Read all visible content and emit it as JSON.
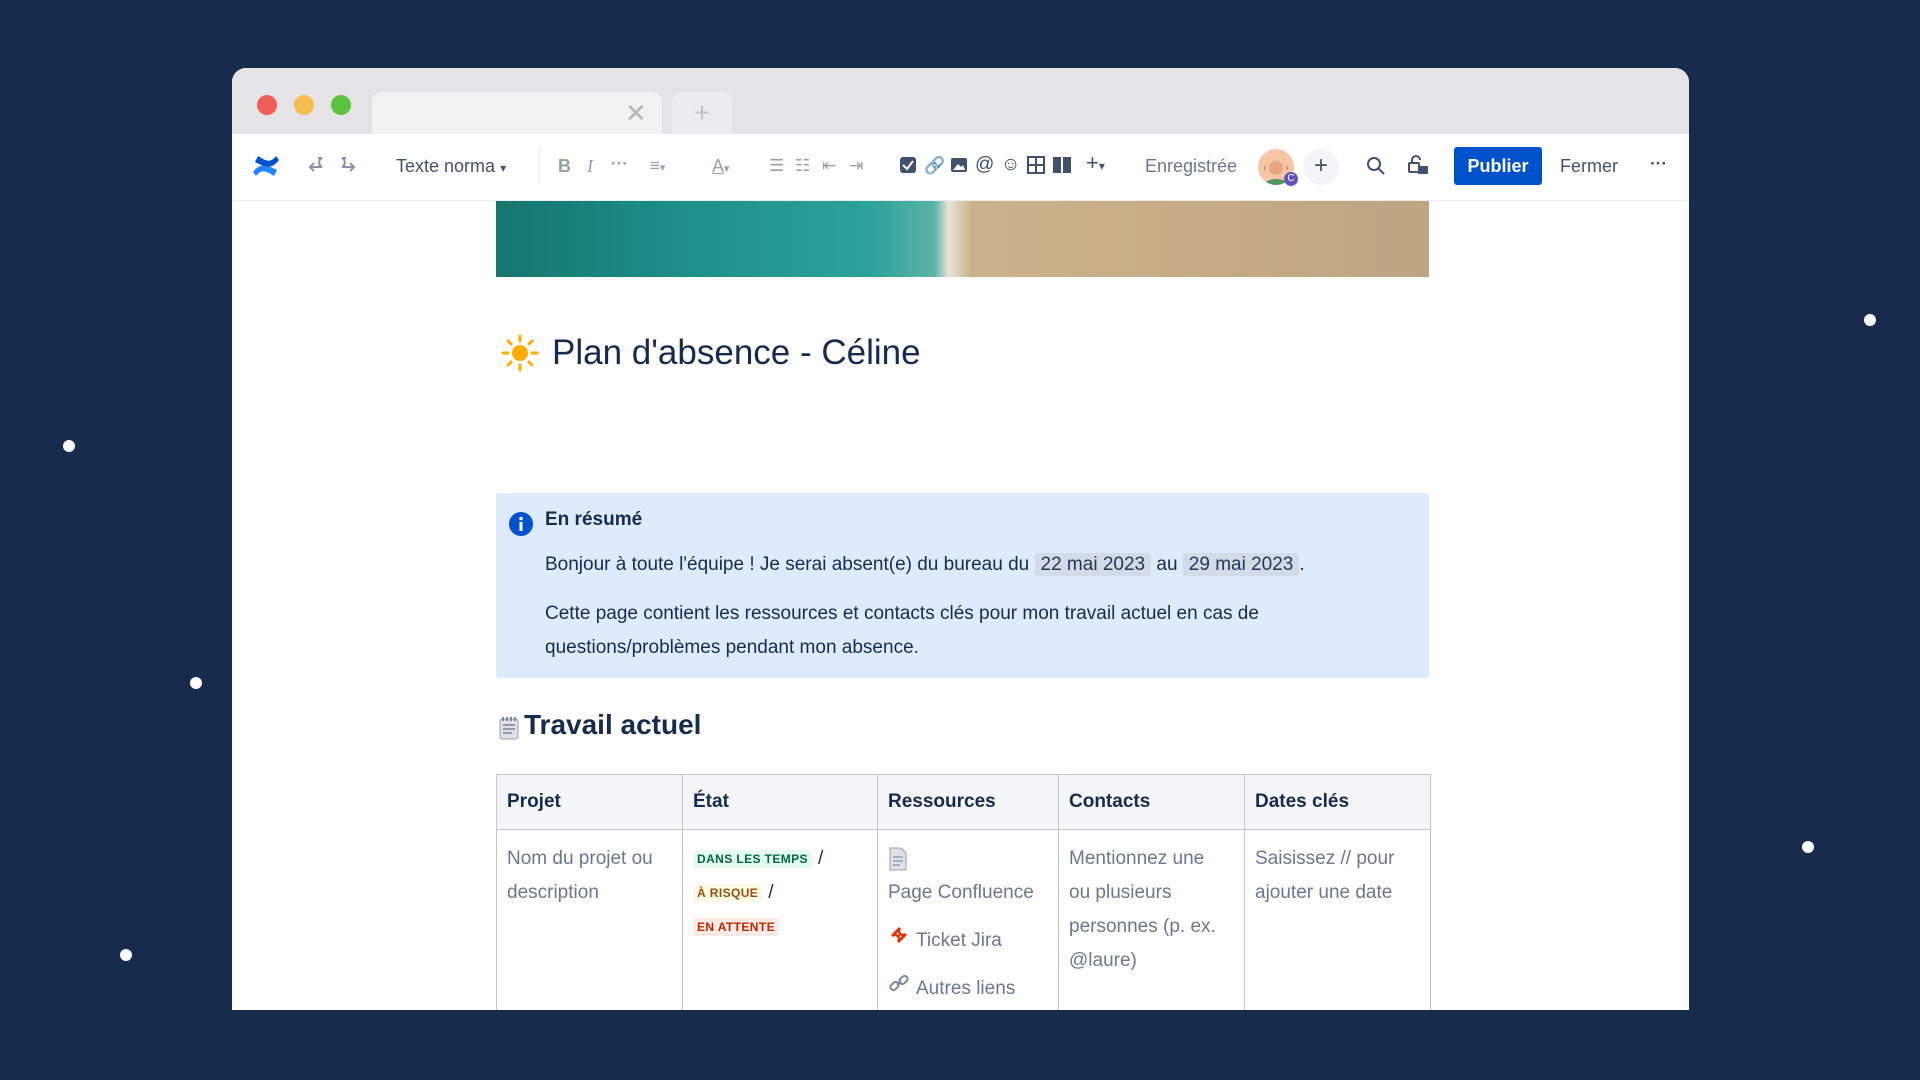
{
  "toolbar": {
    "text_style": "Texte norma",
    "saved_status": "Enregistrée",
    "avatar_badge": "C",
    "publish_label": "Publier",
    "close_label": "Fermer"
  },
  "page": {
    "title": "Plan d'absence - Céline"
  },
  "summary": {
    "title": "En résumé",
    "text_before": "Bonjour à toute l'équipe ! Je serai absent(e) du bureau du",
    "date_start": "22 mai 2023",
    "connector": "au",
    "date_end": "29 mai 2023",
    "text_after": ".",
    "paragraph2_line1": "Cette page contient les ressources et contacts clés pour mon travail actuel en cas de",
    "paragraph2_line2": "questions/problèmes pendant mon absence."
  },
  "section": {
    "title": "Travail actuel"
  },
  "table": {
    "headers": [
      "Projet",
      "État",
      "Ressources",
      "Contacts",
      "Dates clés"
    ],
    "project_lines": [
      "Nom du projet ou",
      "description"
    ],
    "statuses": [
      {
        "label": "DANS LES TEMPS",
        "color": "#006644",
        "bg": "#e3fcef"
      },
      {
        "label": "À RISQUE",
        "color": "#974f0c",
        "bg": "#fffae6"
      },
      {
        "label": "EN ATTENTE",
        "color": "#bf2600",
        "bg": "#ffebe6"
      }
    ],
    "slash": "/",
    "resources": {
      "page": "Page Confluence",
      "jira": "Ticket Jira",
      "links": "Autres liens"
    },
    "contacts_lines": [
      "Mentionnez une",
      "ou plusieurs",
      "personnes (p. ex.",
      "@laure)"
    ],
    "dates_lines": [
      "Saisissez // pour",
      "ajouter une date"
    ]
  },
  "colors": {
    "background": "#172b4d",
    "primary": "#0052cc",
    "info_panel": "#deebff"
  }
}
